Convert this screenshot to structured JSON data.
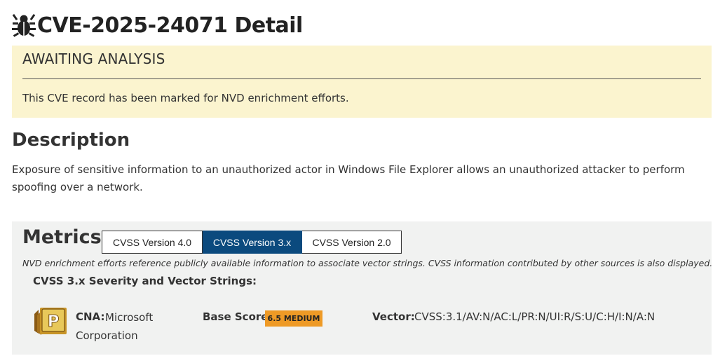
{
  "page": {
    "title": "CVE-2025-24071 Detail",
    "title_icon": "bug-icon"
  },
  "notice": {
    "status": "AWAITING ANALYSIS",
    "text": "This CVE record has been marked for NVD enrichment efforts."
  },
  "description": {
    "heading": "Description",
    "text": "Exposure of sensitive information to an unauthorized actor in Windows File Explorer allows an unauthorized attacker to perform spoofing over a network."
  },
  "metrics": {
    "heading": "Metrics",
    "tabs": [
      {
        "label": "CVSS Version 4.0",
        "active": false
      },
      {
        "label": "CVSS Version 3.x",
        "active": true
      },
      {
        "label": "CVSS Version 2.0",
        "active": false
      }
    ],
    "note": "NVD enrichment efforts reference publicly available information to associate vector strings. CVSS information contributed by other sources is also displayed.",
    "subheading": "CVSS 3.x Severity and Vector Strings:",
    "cna": {
      "label": "CNA:",
      "value": "Microsoft Corporation",
      "badge_icon": "provider-badge-icon",
      "badge_letter": "P"
    },
    "base_score": {
      "label": "Base Score:",
      "value": "6.5 MEDIUM",
      "color": "#ee9a26"
    },
    "vector": {
      "label": "Vector:",
      "value": "CVSS:3.1/AV:N/AC:L/PR:N/UI:R/S:U/C:H/I:N/A:N"
    }
  },
  "colors": {
    "notice_bg": "#fbf4cf",
    "metrics_bg": "#f1f2f1",
    "tab_active": "#0b4a7e"
  }
}
